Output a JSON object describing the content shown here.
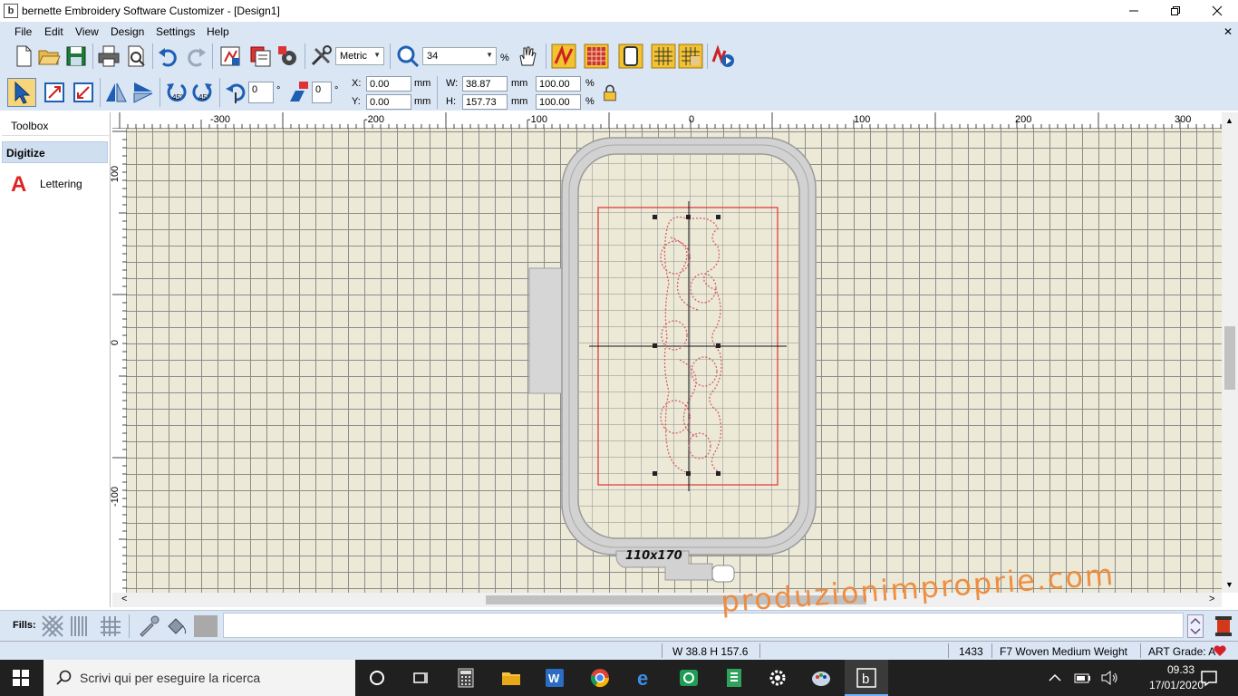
{
  "window": {
    "app_icon": "b",
    "title": "bernette Embroidery Software Customizer - [Design1]",
    "minimize_icon": "minimize-icon",
    "maximize_icon": "restore-icon",
    "close_icon": "close-icon",
    "panel_close": "✕"
  },
  "menu": [
    "File",
    "Edit",
    "View",
    "Design",
    "Settings",
    "Help"
  ],
  "toolbar": {
    "units": "Metric",
    "zoom": "34",
    "zoom_unit": "%"
  },
  "transform": {
    "rotate_value": "0",
    "rotate_unit": "°",
    "slant_value": "0",
    "slant_unit": "°",
    "x_label": "X:",
    "x_value": "0.00",
    "y_label": "Y:",
    "y_value": "0.00",
    "w_label": "W:",
    "w_value": "38.87",
    "h_label": "H:",
    "h_value": "157.73",
    "unit_mm": "mm",
    "scale_w": "100.00",
    "scale_h": "100.00",
    "percent": "%"
  },
  "sidebar": {
    "toolbox": "Toolbox",
    "digitize": "Digitize",
    "lettering_icon": "A",
    "lettering": "Lettering"
  },
  "ruler_top": [
    "-300",
    "-200",
    "-100",
    "0",
    "100",
    "200",
    "300"
  ],
  "ruler_left": [
    "100",
    "0",
    "-100"
  ],
  "hoop": {
    "label": "110x170"
  },
  "bottombar": {
    "fills_label": "Fills:"
  },
  "status": {
    "size": "W  38.8 H 157.6",
    "stitches": "1433",
    "fabric": "F7 Woven Medium Weight",
    "art_grade": "ART Grade: A"
  },
  "taskbar": {
    "search_placeholder": "Scrivi qui per eseguire la ricerca",
    "time": "09.33",
    "date": "17/01/2020"
  },
  "watermark": "produzionimproprie.com",
  "colors": {
    "canvas_bg": "#ede9d7",
    "grid": "#8c8c8c",
    "toolbar_bg": "#dbe6f4",
    "hoop": "#c8c8c8",
    "selection": "#e03030",
    "stitch": "#d2606e",
    "watermark": "#ee8a3c"
  }
}
